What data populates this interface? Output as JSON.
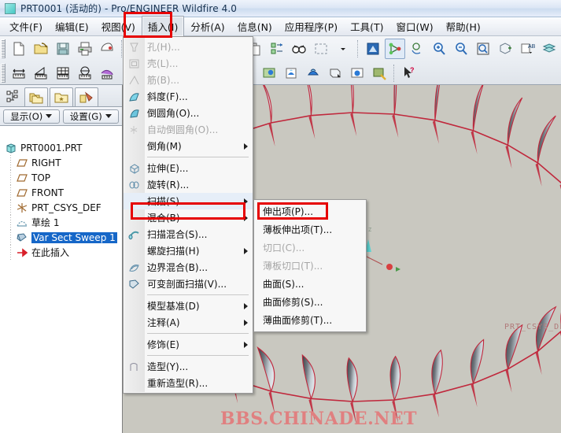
{
  "window": {
    "title": "PRT0001 (活动的) - Pro/ENGINEER Wildfire 4.0",
    "icon": "part-window-icon"
  },
  "menubar": {
    "items": [
      {
        "label": "文件(F)",
        "active": false
      },
      {
        "label": "编辑(E)",
        "active": false
      },
      {
        "label": "视图(V)",
        "active": false
      },
      {
        "label": "插入(I)",
        "active": true
      },
      {
        "label": "分析(A)",
        "active": false
      },
      {
        "label": "信息(N)",
        "active": false
      },
      {
        "label": "应用程序(P)",
        "active": false
      },
      {
        "label": "工具(T)",
        "active": false
      },
      {
        "label": "窗口(W)",
        "active": false
      },
      {
        "label": "帮助(H)",
        "active": false
      }
    ]
  },
  "toolbar": {
    "row1": [
      "new-file-icon",
      "open-folder-icon",
      "save-icon",
      "print-icon",
      "mouse-sketch-icon",
      "sep",
      "regenerate-icon",
      "feature-icon",
      "shell-icon",
      "rib-icon",
      "draft-icon",
      "sep",
      "copy-icon",
      "paste-special-icon",
      "find-icon",
      "selection-box-icon",
      "chevron-down-icon",
      "sep",
      "repaint-icon",
      "datum-display-icon",
      "spin-center-icon",
      "zoom-in-icon",
      "zoom-out-icon",
      "zoom-window-icon",
      "refit-icon",
      "layer-text-icon",
      "layers-icon"
    ],
    "row2": [
      "measure-distance-icon",
      "measure-angle-icon",
      "measure-area-icon",
      "measure-diameter-icon",
      "relation-icon",
      "analysis-icon",
      "sep",
      "color-appearance-icon",
      "render-icon",
      "perspective-icon",
      "light-icon",
      "scene-icon",
      "env-icon",
      "view-saved-icon",
      "view-default-icon",
      "shade-icon",
      "render-region-icon",
      "render-setup-icon",
      "sep",
      "help-pointer-icon"
    ]
  },
  "left_panel": {
    "tabs": [
      {
        "name": "model-tree-icon",
        "selected": false,
        "plain": true
      },
      {
        "name": "folder-browser-icon",
        "selected": true,
        "plain": false
      },
      {
        "name": "favorites-folder-icon",
        "selected": false,
        "plain": false
      },
      {
        "name": "connections-icon",
        "selected": false,
        "plain": false
      }
    ],
    "buttons": [
      {
        "label": "显示(O)",
        "name": "show-dropdown"
      },
      {
        "label": "设置(G)",
        "name": "settings-dropdown"
      }
    ],
    "tree": [
      {
        "label": "PRT0001.PRT",
        "icon": "part-icon",
        "depth": 0,
        "selected": false
      },
      {
        "label": "RIGHT",
        "icon": "datum-plane-icon",
        "depth": 1,
        "selected": false
      },
      {
        "label": "TOP",
        "icon": "datum-plane-icon",
        "depth": 1,
        "selected": false
      },
      {
        "label": "FRONT",
        "icon": "datum-plane-icon",
        "depth": 1,
        "selected": false
      },
      {
        "label": "PRT_CSYS_DEF",
        "icon": "coord-system-icon",
        "depth": 1,
        "selected": false
      },
      {
        "label": "草绘 1",
        "icon": "sketch-icon",
        "depth": 1,
        "selected": false
      },
      {
        "label": "Var Sect Sweep 1",
        "icon": "sweep-icon",
        "depth": 1,
        "selected": true
      },
      {
        "label": "在此插入",
        "icon": "insert-here-icon",
        "depth": 1,
        "selected": false
      }
    ]
  },
  "insert_menu": {
    "items": [
      {
        "label": "孔(H)...",
        "icon": "hole-icon",
        "dim": true,
        "arrow": false
      },
      {
        "label": "壳(L)...",
        "icon": "shell-icon",
        "dim": true,
        "arrow": false
      },
      {
        "label": "筋(B)...",
        "icon": "rib-icon",
        "dim": true,
        "arrow": false
      },
      {
        "label": "斜度(F)...",
        "icon": "draft-icon",
        "dim": false,
        "arrow": false
      },
      {
        "label": "倒圆角(O)...",
        "icon": "round-icon",
        "dim": false,
        "arrow": false
      },
      {
        "label": "自动倒圆角(O)...",
        "icon": "auto-round-icon",
        "dim": true,
        "arrow": false
      },
      {
        "label": "倒角(M)",
        "icon": "chamfer-icon",
        "dim": false,
        "arrow": true
      },
      {
        "sep": true
      },
      {
        "label": "拉伸(E)...",
        "icon": "extrude-icon",
        "dim": false,
        "arrow": false
      },
      {
        "label": "旋转(R)...",
        "icon": "revolve-icon",
        "dim": false,
        "arrow": false
      },
      {
        "label": "扫描(S)",
        "icon": "",
        "dim": false,
        "arrow": true,
        "highlight": true
      },
      {
        "label": "混合(B)",
        "icon": "",
        "dim": false,
        "arrow": true
      },
      {
        "label": "扫描混合(S)...",
        "icon": "swept-blend-icon",
        "dim": false,
        "arrow": false
      },
      {
        "label": "螺旋扫描(H)",
        "icon": "",
        "dim": false,
        "arrow": true
      },
      {
        "label": "边界混合(B)...",
        "icon": "boundary-blend-icon",
        "dim": false,
        "arrow": false
      },
      {
        "label": "可变剖面扫描(V)...",
        "icon": "var-section-sweep-icon",
        "dim": false,
        "arrow": false
      },
      {
        "sep": true
      },
      {
        "label": "模型基准(D)",
        "icon": "",
        "dim": false,
        "arrow": true
      },
      {
        "label": "注释(A)",
        "icon": "",
        "dim": false,
        "arrow": true
      },
      {
        "sep": true
      },
      {
        "label": "修饰(E)",
        "icon": "",
        "dim": false,
        "arrow": true
      },
      {
        "sep": true
      },
      {
        "label": "造型(Y)...",
        "icon": "style-icon",
        "dim": false,
        "arrow": false
      },
      {
        "label": "重新造型(R)...",
        "icon": "",
        "dim": false,
        "arrow": false
      }
    ]
  },
  "sweep_submenu": {
    "items": [
      {
        "label": "伸出项(P)...",
        "dim": false,
        "highlight": true
      },
      {
        "label": "薄板伸出项(T)...",
        "dim": false
      },
      {
        "label": "切口(C)...",
        "dim": true
      },
      {
        "label": "薄板切口(T)...",
        "dim": true
      },
      {
        "label": "曲面(S)...",
        "dim": false
      },
      {
        "label": "曲面修剪(S)...",
        "dim": false
      },
      {
        "label": "薄曲面修剪(T)...",
        "dim": false
      }
    ]
  },
  "viewport": {
    "csys_label": "PRT_CSYS_DEF",
    "watermark": "BBS.CHINADE.NET",
    "background_color": "#c9c8c0",
    "edge_color": "#c0283c",
    "blade_count": 34
  },
  "colors": {
    "highlight_red": "#e60000",
    "selection_blue": "#1667c8",
    "watermark_red": "#e08080",
    "model_edge": "#c0283c"
  }
}
